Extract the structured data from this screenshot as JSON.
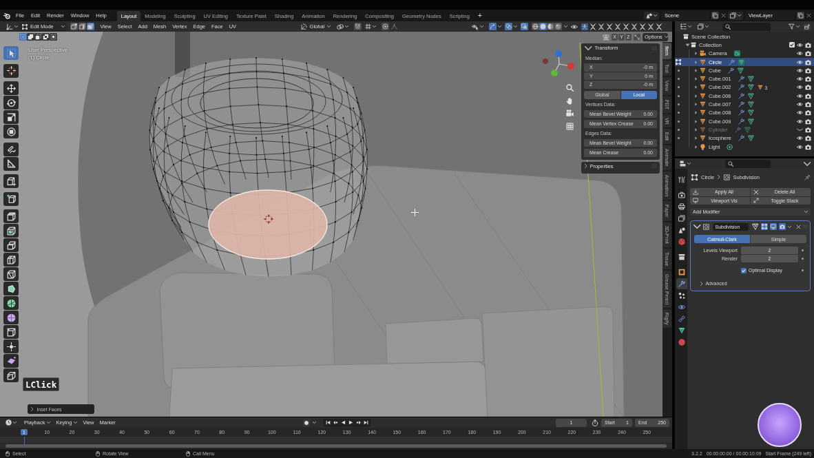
{
  "top_bar": {
    "menus": [
      "File",
      "Edit",
      "Render",
      "Window",
      "Help"
    ],
    "workspaces": [
      {
        "label": "Layout",
        "selected": true
      },
      {
        "label": "Modeling",
        "selected": false
      },
      {
        "label": "Sculpting",
        "selected": false
      },
      {
        "label": "UV Editing",
        "selected": false
      },
      {
        "label": "Texture Paint",
        "selected": false
      },
      {
        "label": "Shading",
        "selected": false
      },
      {
        "label": "Animation",
        "selected": false
      },
      {
        "label": "Rendering",
        "selected": false
      },
      {
        "label": "Compositing",
        "selected": false
      },
      {
        "label": "Geometry Nodes",
        "selected": false
      },
      {
        "label": "Scripting",
        "selected": false
      }
    ],
    "add_workspace": "+",
    "scene": "Scene",
    "view_layer": "ViewLayer"
  },
  "viewport_header": {
    "mode": "Edit Mode",
    "select_modes": [
      {
        "kind": "vertex",
        "selected": false
      },
      {
        "kind": "edge",
        "selected": false
      },
      {
        "kind": "face",
        "selected": true
      }
    ],
    "menus": [
      "View",
      "Select",
      "Add",
      "Mesh",
      "Vertex",
      "Edge",
      "Face",
      "UV"
    ],
    "orientation": "Global",
    "transform_toggles": [
      {
        "kind": "snap",
        "on": false
      },
      {
        "kind": "proportional",
        "on": false
      }
    ],
    "view_toggles": [
      {
        "kind": "gizmo",
        "on": true
      },
      {
        "kind": "overlay",
        "on": true
      },
      {
        "kind": "xray",
        "on": true
      }
    ],
    "shading": [
      {
        "kind": "wireframe",
        "selected": false
      },
      {
        "kind": "solid",
        "selected": true
      },
      {
        "kind": "material",
        "selected": false
      },
      {
        "kind": "rendered",
        "selected": false
      }
    ],
    "addon_buttons": [
      {
        "kind": "figure",
        "on": true
      },
      {
        "kind": "chevrons",
        "on": false
      },
      {
        "kind": "chevrons",
        "on": false
      },
      {
        "kind": "chevrons",
        "on": false
      },
      {
        "kind": "chevrons",
        "on": false
      },
      {
        "kind": "chevrons",
        "on": false
      },
      {
        "kind": "chevrons",
        "on": false
      },
      {
        "kind": "chevrons",
        "on": false
      },
      {
        "kind": "chevrons",
        "on": false
      },
      {
        "kind": "chevrons",
        "on": false
      }
    ],
    "selection_modes": [
      {
        "kind": "set",
        "selected": true
      },
      {
        "kind": "extend",
        "selected": false
      },
      {
        "kind": "subtract",
        "selected": false
      },
      {
        "kind": "difference",
        "selected": false
      },
      {
        "kind": "intersect",
        "selected": false
      }
    ],
    "mirror_axes": [
      {
        "label": "X",
        "on": false
      },
      {
        "label": "Y",
        "on": false
      },
      {
        "label": "Z",
        "on": false
      }
    ],
    "options": "Options"
  },
  "viewport": {
    "view_name": "User Perspective",
    "object_label": "(1) Circle",
    "tool_groups": [
      [
        {
          "kind": "select_box",
          "selected": true
        }
      ],
      [
        {
          "kind": "cursor",
          "selected": false
        }
      ],
      [
        {
          "kind": "move",
          "selected": false
        },
        {
          "kind": "rotate",
          "selected": false
        },
        {
          "kind": "scale",
          "selected": false
        },
        {
          "kind": "transform",
          "selected": false
        }
      ],
      [
        {
          "kind": "annotate",
          "selected": false
        },
        {
          "kind": "measure",
          "selected": false
        }
      ],
      [
        {
          "kind": "box_plus",
          "selected": false
        }
      ],
      [
        {
          "kind": "add_cube",
          "selected": false
        }
      ],
      [
        {
          "kind": "extrude",
          "selected": false
        },
        {
          "kind": "inset",
          "selected": false
        },
        {
          "kind": "bevel",
          "selected": false
        },
        {
          "kind": "loop_cut",
          "selected": false
        },
        {
          "kind": "knife",
          "selected": false
        },
        {
          "kind": "poly_build",
          "selected": false
        },
        {
          "kind": "spin",
          "selected": false
        },
        {
          "kind": "smooth",
          "selected": false
        },
        {
          "kind": "edge_slide",
          "selected": false
        },
        {
          "kind": "shrink",
          "selected": false
        },
        {
          "kind": "shear",
          "selected": false
        },
        {
          "kind": "rip",
          "selected": false
        }
      ]
    ],
    "key_overlay": "LClick",
    "last_operator": {
      "label": "Inset Faces",
      "expanded": false
    }
  },
  "sidebar": {
    "tabs": [
      {
        "label": "Item",
        "selected": true
      },
      {
        "label": "Tool",
        "selected": false
      },
      {
        "label": "View",
        "selected": false
      },
      {
        "label": "PDT",
        "selected": false
      },
      {
        "label": "VR",
        "selected": false
      },
      {
        "label": "Edit",
        "selected": false
      },
      {
        "label": "Animate",
        "selected": false
      },
      {
        "label": "Animation",
        "selected": false
      },
      {
        "label": "Paper",
        "selected": false
      },
      {
        "label": "3D-Print",
        "selected": false
      },
      {
        "label": "Tissue",
        "selected": false
      },
      {
        "label": "Grease Pencil",
        "selected": false
      },
      {
        "label": "Rigify",
        "selected": false
      }
    ],
    "panels": [
      {
        "title": "Transform",
        "expanded": true,
        "sections": [
          {
            "label": "Median:",
            "fields": [
              {
                "label": "X",
                "value": "-0 m"
              },
              {
                "label": "Y",
                "value": "0 m"
              },
              {
                "label": "Z",
                "value": "-0 m"
              }
            ],
            "space": [
              {
                "label": "Global",
                "selected": false
              },
              {
                "label": "Local",
                "selected": true
              }
            ]
          },
          {
            "label": "Vertices Data:",
            "fields": [
              {
                "label": "Mean Bevel Weight",
                "value": "0.00"
              },
              {
                "label": "Mean Vertex Crease",
                "value": "0.00"
              }
            ]
          },
          {
            "label": "Edges Data:",
            "fields": [
              {
                "label": "Mean Bevel Weight",
                "value": "0.00"
              },
              {
                "label": "Mean Crease",
                "value": "0.00"
              }
            ]
          }
        ]
      },
      {
        "title": "Properties",
        "expanded": false
      }
    ]
  },
  "outliner": {
    "root": {
      "name": "Scene Collection",
      "children": [
        {
          "name": "Collection",
          "kind": "collection",
          "expanded": true,
          "checked": true,
          "children": [
            {
              "name": "Camera",
              "kind": "camera",
              "expanded": false,
              "selected": false,
              "hidden": false,
              "edit_mode": false,
              "modifier": false,
              "data_active": true
            },
            {
              "name": "Circle",
              "kind": "mesh",
              "expanded": false,
              "selected": true,
              "hidden": false,
              "edit_mode": true,
              "modifier": true,
              "data_active": true
            },
            {
              "name": "Cube",
              "kind": "mesh",
              "expanded": false,
              "selected": false,
              "hidden": false,
              "edit_mode": false,
              "modifier": true,
              "data_active": false
            },
            {
              "name": "Cube.001",
              "kind": "mesh",
              "expanded": false,
              "selected": false,
              "hidden": false,
              "edit_mode": false,
              "modifier": true,
              "data_active": false
            },
            {
              "name": "Cube.002",
              "kind": "mesh",
              "expanded": false,
              "selected": false,
              "hidden": false,
              "edit_mode": false,
              "modifier": true,
              "data_active": false,
              "child_count": "3"
            },
            {
              "name": "Cube.006",
              "kind": "mesh",
              "expanded": false,
              "selected": false,
              "hidden": false,
              "edit_mode": false,
              "modifier": true,
              "data_active": false
            },
            {
              "name": "Cube.007",
              "kind": "mesh",
              "expanded": false,
              "selected": false,
              "hidden": false,
              "edit_mode": false,
              "modifier": true,
              "data_active": false
            },
            {
              "name": "Cube.008",
              "kind": "mesh",
              "expanded": false,
              "selected": false,
              "hidden": false,
              "edit_mode": false,
              "modifier": true,
              "data_active": false
            },
            {
              "name": "Cube.009",
              "kind": "mesh",
              "expanded": false,
              "selected": false,
              "hidden": false,
              "edit_mode": false,
              "modifier": true,
              "data_active": false
            },
            {
              "name": "Cylinder",
              "kind": "mesh",
              "expanded": false,
              "selected": false,
              "hidden": true,
              "edit_mode": false,
              "modifier": true,
              "data_active": false
            },
            {
              "name": "Icosphere",
              "kind": "mesh",
              "expanded": false,
              "selected": false,
              "hidden": false,
              "edit_mode": false,
              "modifier": true,
              "data_active": false
            },
            {
              "name": "Light",
              "kind": "light",
              "expanded": false,
              "selected": false,
              "hidden": false,
              "edit_mode": false,
              "modifier": false,
              "data_active": false
            }
          ]
        }
      ]
    }
  },
  "properties": {
    "tab_groups": [
      [
        {
          "kind": "tool",
          "selected": false
        }
      ],
      [
        {
          "kind": "render",
          "selected": false
        },
        {
          "kind": "output",
          "selected": false
        },
        {
          "kind": "view_layer",
          "selected": false
        },
        {
          "kind": "scene",
          "selected": false
        },
        {
          "kind": "world",
          "selected": false
        }
      ],
      [
        {
          "kind": "collection",
          "selected": false
        }
      ],
      [
        {
          "kind": "object",
          "selected": false
        },
        {
          "kind": "modifiers",
          "selected": true
        },
        {
          "kind": "particles",
          "selected": false
        },
        {
          "kind": "physics",
          "selected": false
        },
        {
          "kind": "constraints",
          "selected": false
        },
        {
          "kind": "data",
          "selected": false
        },
        {
          "kind": "material",
          "selected": false
        }
      ]
    ],
    "breadcrumb": [
      {
        "kind": "object",
        "label": "Circle"
      },
      {
        "kind": "modifier",
        "label": "Subdivision"
      }
    ],
    "actions": [
      {
        "kind": "apply",
        "label": "Apply All"
      },
      {
        "kind": "delete",
        "label": "Delete All"
      },
      {
        "kind": "viewport",
        "label": "Viewport Vis"
      },
      {
        "kind": "stack",
        "label": "Toggle Stack"
      }
    ],
    "add_modifier": "Add Modifier",
    "modifiers": [
      {
        "name": "Subdivision",
        "expanded": true,
        "toggles": [
          {
            "kind": "on_cage",
            "on": false
          },
          {
            "kind": "edit_mode",
            "on": true
          },
          {
            "kind": "viewport",
            "on": true
          },
          {
            "kind": "render",
            "on": true
          }
        ],
        "types": [
          {
            "label": "Catmull-Clark",
            "selected": true
          },
          {
            "label": "Simple",
            "selected": false
          }
        ],
        "fields": [
          {
            "label": "Levels Viewport",
            "value": "2"
          },
          {
            "label": "Render",
            "value": "2"
          }
        ],
        "options": [
          {
            "label": "Optimal Display",
            "checked": true
          }
        ],
        "subpanels": [
          {
            "label": "Advanced",
            "expanded": false
          }
        ]
      }
    ]
  },
  "timeline": {
    "menus": [
      {
        "label": "Playback",
        "kind": "dropdown"
      },
      {
        "label": "Keying",
        "kind": "dropdown"
      },
      {
        "label": "View",
        "kind": "menu"
      },
      {
        "label": "Marker",
        "kind": "menu"
      }
    ],
    "auto_keying": false,
    "current_frame": "1",
    "start_label": "Start",
    "start": "1",
    "end_label": "End",
    "end": "250",
    "ruler": [
      {
        "label": "1",
        "current": true
      },
      {
        "label": "10",
        "current": false
      },
      {
        "label": "20",
        "current": false
      },
      {
        "label": "30",
        "current": false
      },
      {
        "label": "40",
        "current": false
      },
      {
        "label": "50",
        "current": false
      },
      {
        "label": "60",
        "current": false
      },
      {
        "label": "70",
        "current": false
      },
      {
        "label": "80",
        "current": false
      },
      {
        "label": "90",
        "current": false
      },
      {
        "label": "100",
        "current": false
      },
      {
        "label": "110",
        "current": false
      },
      {
        "label": "120",
        "current": false
      },
      {
        "label": "130",
        "current": false
      },
      {
        "label": "140",
        "current": false
      },
      {
        "label": "150",
        "current": false
      },
      {
        "label": "160",
        "current": false
      },
      {
        "label": "170",
        "current": false
      },
      {
        "label": "180",
        "current": false
      },
      {
        "label": "190",
        "current": false
      },
      {
        "label": "200",
        "current": false
      },
      {
        "label": "210",
        "current": false
      },
      {
        "label": "220",
        "current": false
      },
      {
        "label": "230",
        "current": false
      },
      {
        "label": "240",
        "current": false
      },
      {
        "label": "250",
        "current": false
      }
    ]
  },
  "status_bar": {
    "hints": [
      {
        "kind": "left_click",
        "label": "Select"
      },
      {
        "kind": "middle_click",
        "label": "Rotate View"
      },
      {
        "kind": "right_click",
        "label": "Call Menu"
      }
    ],
    "version": "3.2.2",
    "time": "00:00:00:00 / 00:00:10:09",
    "frame_info": "Start Frame (249 left)"
  }
}
